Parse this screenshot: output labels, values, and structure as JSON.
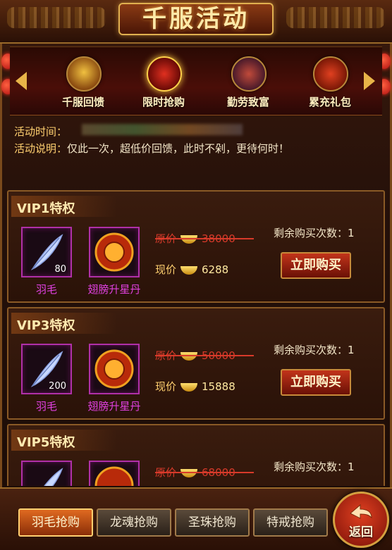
{
  "title": "千服活动",
  "activity_tabs": [
    {
      "label": "千服回馈",
      "icon": "gift-bag-icon"
    },
    {
      "label": "限时抢购",
      "icon": "gift-box-clock-icon",
      "selected": true
    },
    {
      "label": "勤劳致富",
      "icon": "crossed-swords-icon"
    },
    {
      "label": "累充礼包",
      "icon": "treasure-sack-icon"
    }
  ],
  "info": {
    "time_label": "活动时间：",
    "desc_label": "活动说明：",
    "desc_value": "仅此一次，超低价回馈，此时不剁，更待何时！"
  },
  "cards": [
    {
      "title": "VIP1特权",
      "items": [
        {
          "name": "羽毛",
          "count": "80",
          "icon": "feather-icon"
        },
        {
          "name": "翅膀升星丹",
          "count": "",
          "icon": "star-orb-icon"
        }
      ],
      "orig_label": "原价",
      "orig_price": "38000",
      "now_label": "现价",
      "now_price": "6288",
      "remain_label": "剩余购买次数：",
      "remain": "1",
      "buy_label": "立即购买"
    },
    {
      "title": "VIP3特权",
      "items": [
        {
          "name": "羽毛",
          "count": "200",
          "icon": "feather-icon"
        },
        {
          "name": "翅膀升星丹",
          "count": "",
          "icon": "star-orb-icon"
        }
      ],
      "orig_label": "原价",
      "orig_price": "50000",
      "now_label": "现价",
      "now_price": "15888",
      "remain_label": "剩余购买次数：",
      "remain": "1",
      "buy_label": "立即购买"
    },
    {
      "title": "VIP5特权",
      "items": [
        {
          "name": "",
          "count": "",
          "icon": "feather-icon"
        },
        {
          "name": "",
          "count": "",
          "icon": "star-orb-icon"
        }
      ],
      "orig_label": "原价",
      "orig_price": "68000",
      "now_label": "",
      "now_price": "",
      "remain_label": "剩余购买次数：",
      "remain": "1",
      "buy_label": ""
    }
  ],
  "bottom_tabs": [
    {
      "label": "羽毛抢购",
      "active": true
    },
    {
      "label": "龙魂抢购"
    },
    {
      "label": "圣珠抢购"
    },
    {
      "label": "特戒抢购"
    }
  ],
  "back_label": "返回",
  "colors": {
    "gold": "#ffd070",
    "orig_price_red": "#d83a2a",
    "item_name_magenta": "#e040e0",
    "slot_border_purple": "#b030a8"
  }
}
